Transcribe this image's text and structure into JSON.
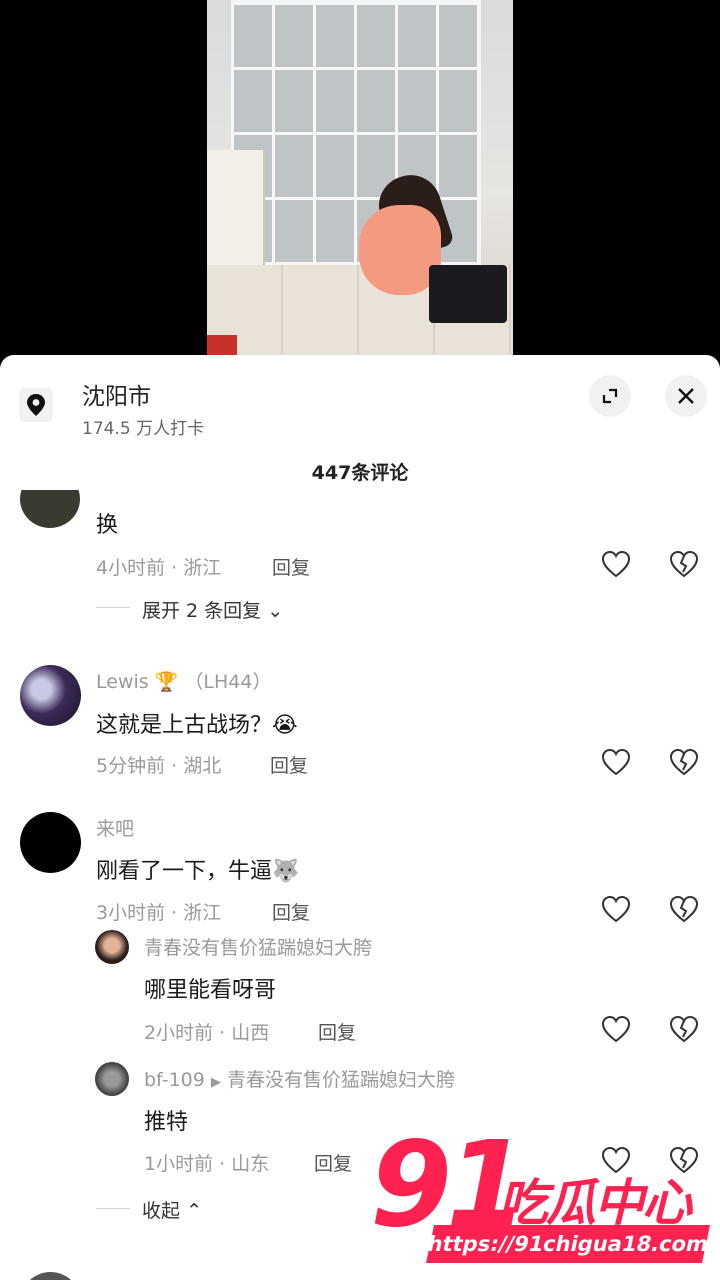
{
  "location": {
    "title": "沈阳市",
    "checkins": "174.5 万人打卡"
  },
  "comment_count": "447条评论",
  "colors": {
    "accent": "#ff2150",
    "meta": "#9a9a9a"
  },
  "comments": [
    {
      "text": "换",
      "time_region": "4小时前 · 浙江",
      "reply_label": "回复",
      "expand_label": "展开 2 条回复"
    },
    {
      "user": "Lewis 🏆 （LH44）",
      "text": "这就是上古战场？😭",
      "time_region": "5分钟前 · 湖北",
      "reply_label": "回复"
    },
    {
      "user": "来吧",
      "text": "刚看了一下，牛逼🐺",
      "time_region": "3小时前 · 浙江",
      "reply_label": "回复",
      "replies": [
        {
          "user": "青春没有售价猛踹媳妇大胯",
          "text": "哪里能看呀哥",
          "time_region": "2小时前 · 山西",
          "reply_label": "回复"
        },
        {
          "user": "bf-109",
          "reply_to": "青春没有售价猛踹媳妇大胯",
          "text": "推特",
          "time_region": "1小时前 · 山东",
          "reply_label": "回复"
        }
      ],
      "collapse_label": "收起"
    }
  ],
  "watermark": {
    "number": "91",
    "name": "吃瓜中心",
    "url": "https://91chigua18.com"
  }
}
